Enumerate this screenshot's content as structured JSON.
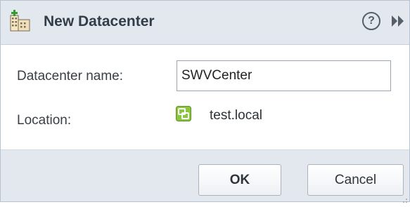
{
  "dialog": {
    "title": "New Datacenter",
    "title_icon": "datacenter-add-icon",
    "help_icon": "help-icon",
    "expand_icon": "expand-icon"
  },
  "form": {
    "name_label": "Datacenter name:",
    "name_value": "SWVCenter",
    "location_label": "Location:",
    "location_icon": "vcenter-icon",
    "location_value": "test.local"
  },
  "buttons": {
    "ok_label": "OK",
    "cancel_label": "Cancel"
  },
  "colors": {
    "titlebar_bg": "#e3e8ee",
    "footer_bg": "#e3e8ee",
    "vcenter_icon": "#8cc63f"
  }
}
